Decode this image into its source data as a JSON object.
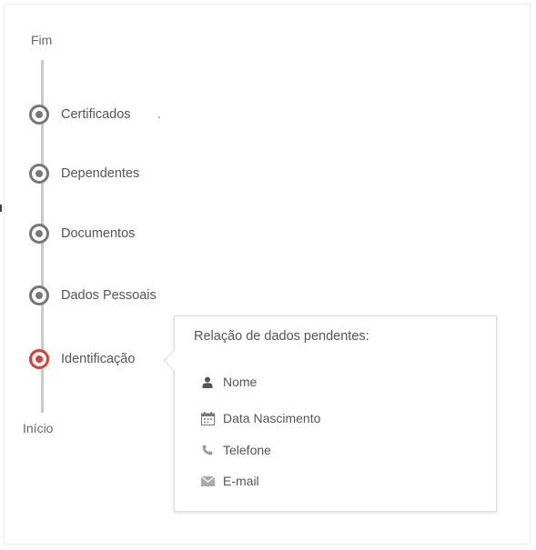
{
  "timeline": {
    "end_label": "Fim",
    "start_label": "Início",
    "steps": [
      {
        "label": "Certificados",
        "active": false
      },
      {
        "label": "Dependentes",
        "active": false
      },
      {
        "label": "Documentos",
        "active": false
      },
      {
        "label": "Dados Pessoais",
        "active": false
      },
      {
        "label": "Identificação",
        "active": true
      }
    ]
  },
  "popover": {
    "title": "Relação de dados pendentes:",
    "items": [
      {
        "label": "Nome",
        "icon": "user-icon"
      },
      {
        "label": "Data Nascimento",
        "icon": "calendar-icon"
      },
      {
        "label": "Telefone",
        "icon": "phone-icon"
      },
      {
        "label": "E-mail",
        "icon": "envelope-icon"
      }
    ]
  },
  "colors": {
    "active": "#e53935",
    "inactive": "#777777",
    "line": "#c9c9c9"
  }
}
